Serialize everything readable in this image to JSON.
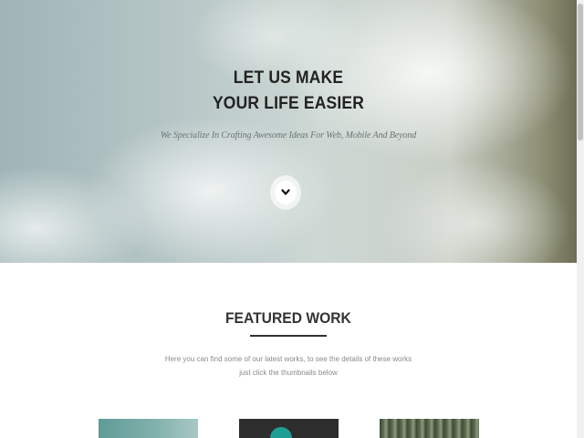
{
  "hero": {
    "title_line1": "LET US MAKE",
    "title_line2": "YOUR LIFE EASIER",
    "subtitle": "We Specialize In Crafting Awesome Ideas For Web, Mobile And Beyond",
    "scroll_icon": "chevron-down-icon"
  },
  "featured": {
    "title": "FEATURED WORK",
    "description_line1": "Here you can find some of our latest works, to see the details of these works",
    "description_line2": "just click the thumbnails below"
  },
  "colors": {
    "heading": "#222222",
    "subtitle": "#6c7474",
    "description": "#8a8a8a",
    "accent": "#1f9e93"
  }
}
